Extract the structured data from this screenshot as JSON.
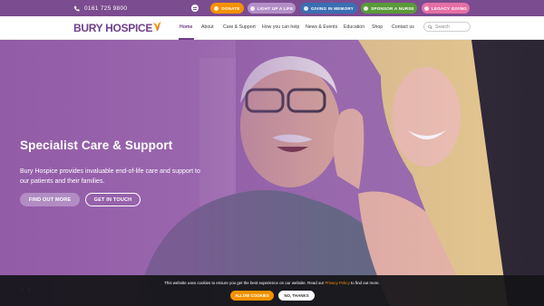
{
  "topbar": {
    "phone": "0161 725 9800",
    "pills": {
      "donate": "DONATE",
      "light_up": "LIGHT UP A LIFE",
      "giving_in_memory": "GIVING IN MEMORY",
      "sponsor": "SPONSOR A NURSE",
      "legacy": "LEGACY GIVING"
    }
  },
  "header": {
    "logo_text": "BURY HOSPICE",
    "nav": {
      "home": "Home",
      "about": "About",
      "care": "Care & Support",
      "help": "How you can help",
      "news": "News & Events",
      "education": "Education",
      "shop": "Shop",
      "contact": "Contact us"
    },
    "active_nav": "Home",
    "search_placeholder": "Search"
  },
  "hero": {
    "title": "Specialist Care & Support",
    "text": "Bury Hospice provides invaluable end-of-life care and support to our patients and their families.",
    "btn_more": "FIND OUT MORE",
    "btn_touch": "GET IN TOUCH"
  },
  "cookie": {
    "text_before": "This website uses cookies to ensure you get the best experience on our website. Read our ",
    "link": "Privacy Policy",
    "text_after": " to find out more.",
    "allow": "ALLOW COOKIES",
    "no": "NO, THANKS"
  },
  "colors": {
    "brand_purple": "#6f3f8a",
    "topbar": "#7b4c8f",
    "donate": "#f39200",
    "light_up": "#b48ec7",
    "memory": "#3a6fb3",
    "sponsor": "#5a9a3a",
    "legacy": "#e56fa6"
  },
  "icons": [
    "phone-icon",
    "accessibility-icon",
    "heart-icon",
    "candle-icon",
    "dove-icon",
    "nurse-icon",
    "legacy-icon",
    "butterfly-icon",
    "search-icon"
  ]
}
